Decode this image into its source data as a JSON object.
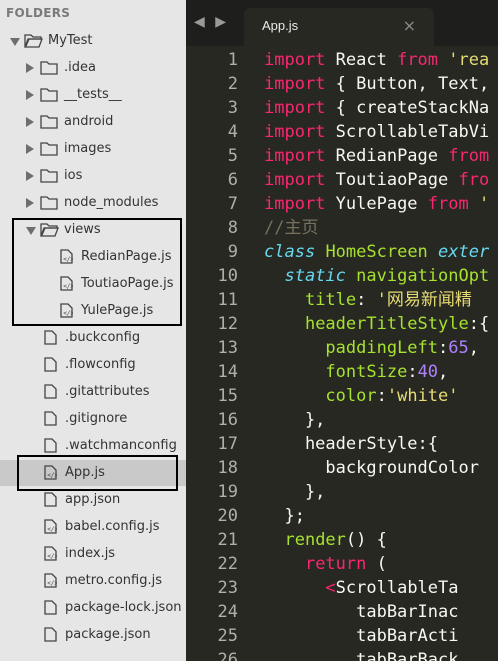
{
  "sidebar": {
    "header": "FOLDERS",
    "items": [
      {
        "label": "MyTest",
        "kind": "folder",
        "state": "open",
        "depth": 0
      },
      {
        "label": ".idea",
        "kind": "folder",
        "state": "closed",
        "depth": 1
      },
      {
        "label": "__tests__",
        "kind": "folder",
        "state": "closed",
        "depth": 1
      },
      {
        "label": "android",
        "kind": "folder",
        "state": "closed",
        "depth": 1
      },
      {
        "label": "images",
        "kind": "folder",
        "state": "closed",
        "depth": 1
      },
      {
        "label": "ios",
        "kind": "folder",
        "state": "closed",
        "depth": 1
      },
      {
        "label": "node_modules",
        "kind": "folder",
        "state": "closed",
        "depth": 1
      },
      {
        "label": "views",
        "kind": "folder",
        "state": "open",
        "depth": 1
      },
      {
        "label": "RedianPage.js",
        "kind": "file",
        "depth": 2
      },
      {
        "label": "ToutiaoPage.js",
        "kind": "file",
        "depth": 2
      },
      {
        "label": "YulePage.js",
        "kind": "file",
        "depth": 2
      },
      {
        "label": ".buckconfig",
        "kind": "file",
        "depth": 1
      },
      {
        "label": ".flowconfig",
        "kind": "file",
        "depth": 1
      },
      {
        "label": ".gitattributes",
        "kind": "file",
        "depth": 1
      },
      {
        "label": ".gitignore",
        "kind": "file",
        "depth": 1
      },
      {
        "label": ".watchmanconfig",
        "kind": "file",
        "depth": 1
      },
      {
        "label": "App.js",
        "kind": "file",
        "depth": 1,
        "selected": true
      },
      {
        "label": "app.json",
        "kind": "file",
        "depth": 1
      },
      {
        "label": "babel.config.js",
        "kind": "file",
        "depth": 1
      },
      {
        "label": "index.js",
        "kind": "file",
        "depth": 1
      },
      {
        "label": "metro.config.js",
        "kind": "file",
        "depth": 1
      },
      {
        "label": "package-lock.json",
        "kind": "file",
        "depth": 1
      },
      {
        "label": "package.json",
        "kind": "file",
        "depth": 1
      }
    ]
  },
  "tabs": {
    "nav_left": "◀",
    "nav_right": "▶",
    "active_title": "App.js",
    "close": "×"
  },
  "code": {
    "lines": [
      {
        "n": "1",
        "tokens": [
          [
            "kw",
            "import"
          ],
          [
            "t",
            " React "
          ],
          [
            "kw",
            "from"
          ],
          [
            "t",
            " "
          ],
          [
            "str",
            "'rea"
          ]
        ]
      },
      {
        "n": "2",
        "tokens": [
          [
            "kw",
            "import"
          ],
          [
            "t",
            " { Button, Text,"
          ]
        ]
      },
      {
        "n": "3",
        "tokens": [
          [
            "kw",
            "import"
          ],
          [
            "t",
            " { createStackNa"
          ]
        ]
      },
      {
        "n": "4",
        "tokens": [
          [
            "kw",
            "import"
          ],
          [
            "t",
            " ScrollableTabVi"
          ]
        ]
      },
      {
        "n": "5",
        "tokens": [
          [
            "kw",
            "import"
          ],
          [
            "t",
            " RedianPage "
          ],
          [
            "kw",
            "from"
          ]
        ]
      },
      {
        "n": "6",
        "tokens": [
          [
            "kw",
            "import"
          ],
          [
            "t",
            " ToutiaoPage "
          ],
          [
            "kw",
            "fro"
          ]
        ]
      },
      {
        "n": "7",
        "tokens": [
          [
            "kw",
            "import"
          ],
          [
            "t",
            " YulePage "
          ],
          [
            "kw",
            "from"
          ],
          [
            "t",
            " "
          ],
          [
            "str",
            "'"
          ]
        ]
      },
      {
        "n": "8",
        "tokens": [
          [
            "cmt",
            "//主页"
          ]
        ]
      },
      {
        "n": "9",
        "tokens": [
          [
            "it",
            "class"
          ],
          [
            "t",
            " "
          ],
          [
            "cls",
            "HomeScreen"
          ],
          [
            "t",
            " "
          ],
          [
            "it",
            "exter"
          ]
        ]
      },
      {
        "n": "10",
        "tokens": [
          [
            "t",
            "  "
          ],
          [
            "it",
            "static"
          ],
          [
            "t",
            " "
          ],
          [
            "fn",
            "navigationOpt"
          ]
        ]
      },
      {
        "n": "11",
        "tokens": [
          [
            "t",
            "    "
          ],
          [
            "prop",
            "title"
          ],
          [
            "t",
            ": "
          ],
          [
            "str",
            "'网易新闻精"
          ]
        ]
      },
      {
        "n": "12",
        "tokens": [
          [
            "t",
            "    "
          ],
          [
            "prop",
            "headerTitleStyle"
          ],
          [
            "t",
            ":{"
          ]
        ]
      },
      {
        "n": "13",
        "tokens": [
          [
            "t",
            "      "
          ],
          [
            "prop",
            "paddingLeft"
          ],
          [
            "t",
            ":"
          ],
          [
            "num",
            "65"
          ],
          [
            "t",
            ","
          ]
        ]
      },
      {
        "n": "14",
        "tokens": [
          [
            "t",
            "      "
          ],
          [
            "prop",
            "fontSize"
          ],
          [
            "t",
            ":"
          ],
          [
            "num",
            "40"
          ],
          [
            "t",
            ","
          ]
        ]
      },
      {
        "n": "15",
        "tokens": [
          [
            "t",
            "      "
          ],
          [
            "prop",
            "color"
          ],
          [
            "t",
            ":"
          ],
          [
            "str",
            "'white'"
          ]
        ]
      },
      {
        "n": "16",
        "tokens": [
          [
            "t",
            "    },"
          ]
        ]
      },
      {
        "n": "17",
        "tokens": [
          [
            "t",
            "    headerStyle:{"
          ]
        ]
      },
      {
        "n": "18",
        "tokens": [
          [
            "t",
            "      backgroundColor"
          ]
        ]
      },
      {
        "n": "19",
        "tokens": [
          [
            "t",
            "    },"
          ]
        ]
      },
      {
        "n": "20",
        "tokens": [
          [
            "t",
            "  };"
          ]
        ]
      },
      {
        "n": "21",
        "tokens": [
          [
            "t",
            "  "
          ],
          [
            "fn",
            "render"
          ],
          [
            "t",
            "() {"
          ]
        ]
      },
      {
        "n": "22",
        "tokens": [
          [
            "t",
            "    "
          ],
          [
            "kw",
            "return"
          ],
          [
            "t",
            " ("
          ]
        ]
      },
      {
        "n": "23",
        "tokens": [
          [
            "t",
            "      "
          ],
          [
            "kw",
            "<"
          ],
          [
            "t",
            "ScrollableTa"
          ]
        ]
      },
      {
        "n": "24",
        "tokens": [
          [
            "t",
            "         tabBarInac"
          ]
        ]
      },
      {
        "n": "25",
        "tokens": [
          [
            "t",
            "         tabBarActi"
          ]
        ]
      },
      {
        "n": "26",
        "tokens": [
          [
            "t",
            "         tabBarBack"
          ]
        ]
      }
    ]
  }
}
